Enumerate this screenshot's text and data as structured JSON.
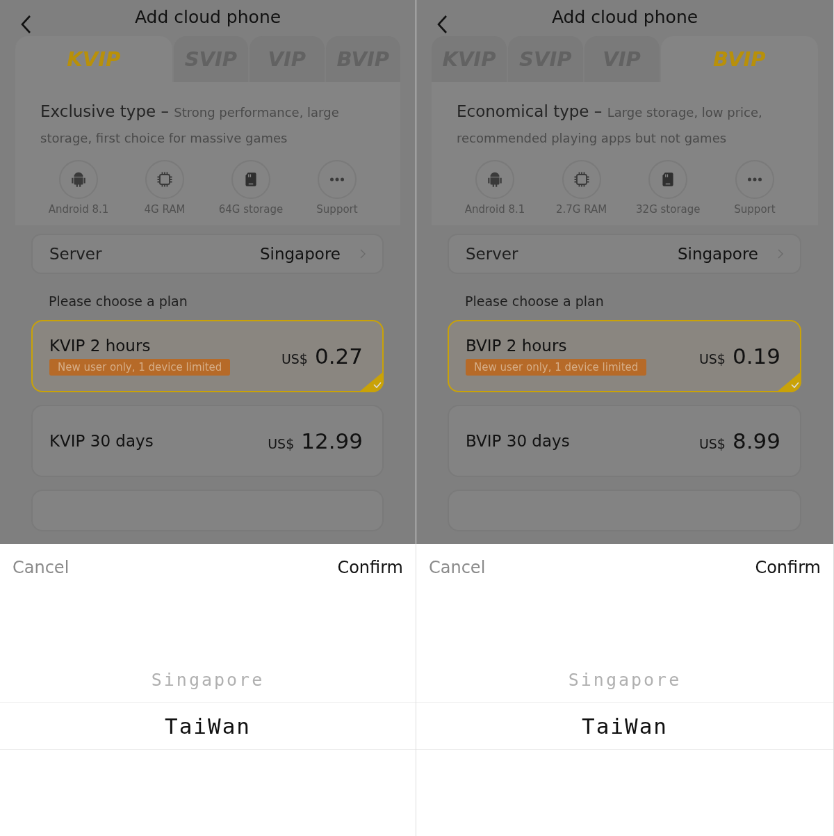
{
  "panels": [
    {
      "title": "Add cloud phone",
      "tabs": [
        {
          "label": "KVIP",
          "selected": true
        },
        {
          "label": "SVIP",
          "selected": false
        },
        {
          "label": "VIP",
          "selected": false
        },
        {
          "label": "BVIP",
          "selected": false
        }
      ],
      "type_title": "Exclusive type",
      "separator": "–",
      "type_desc": "Strong performance, large storage, first choice for massive games",
      "specs": [
        {
          "kind": "android",
          "label": "Android 8.1"
        },
        {
          "kind": "chip",
          "label": "4G RAM"
        },
        {
          "kind": "storage",
          "label": "64G storage"
        },
        {
          "kind": "more",
          "label": "Support"
        }
      ],
      "server": {
        "label": "Server",
        "value": "Singapore"
      },
      "plan_prompt": "Please choose a plan",
      "plans": [
        {
          "kind": "full",
          "name": "KVIP 2 hours",
          "badge": "New user only, 1 device limited",
          "currency": "US$",
          "price": "0.27",
          "selected": true
        },
        {
          "kind": "full",
          "name": "KVIP 30 days",
          "currency": "US$",
          "price": "12.99",
          "selected": false
        },
        {
          "kind": "cut"
        }
      ],
      "picker": {
        "cancel": "Cancel",
        "confirm": "Confirm",
        "options": [
          {
            "label": "Singapore",
            "selected": false
          },
          {
            "label": "TaiWan",
            "selected": true
          }
        ]
      }
    },
    {
      "title": "Add cloud phone",
      "tabs": [
        {
          "label": "KVIP",
          "selected": false
        },
        {
          "label": "SVIP",
          "selected": false
        },
        {
          "label": "VIP",
          "selected": false
        },
        {
          "label": "BVIP",
          "selected": true
        }
      ],
      "type_title": "Economical type",
      "separator": "–",
      "type_desc": "Large storage, low price, recommended playing apps but not games",
      "specs": [
        {
          "kind": "android",
          "label": "Android 8.1"
        },
        {
          "kind": "chip",
          "label": "2.7G RAM"
        },
        {
          "kind": "storage",
          "label": "32G storage"
        },
        {
          "kind": "more",
          "label": "Support"
        }
      ],
      "server": {
        "label": "Server",
        "value": "Singapore"
      },
      "plan_prompt": "Please choose a plan",
      "plans": [
        {
          "kind": "full",
          "name": "BVIP 2 hours",
          "badge": "New user only, 1 device limited",
          "currency": "US$",
          "price": "0.19",
          "selected": true
        },
        {
          "kind": "full",
          "name": "BVIP 30 days",
          "currency": "US$",
          "price": "8.99",
          "selected": false
        },
        {
          "kind": "cut"
        }
      ],
      "picker": {
        "cancel": "Cancel",
        "confirm": "Confirm",
        "options": [
          {
            "label": "Singapore",
            "selected": false
          },
          {
            "label": "TaiWan",
            "selected": true
          }
        ]
      }
    }
  ]
}
